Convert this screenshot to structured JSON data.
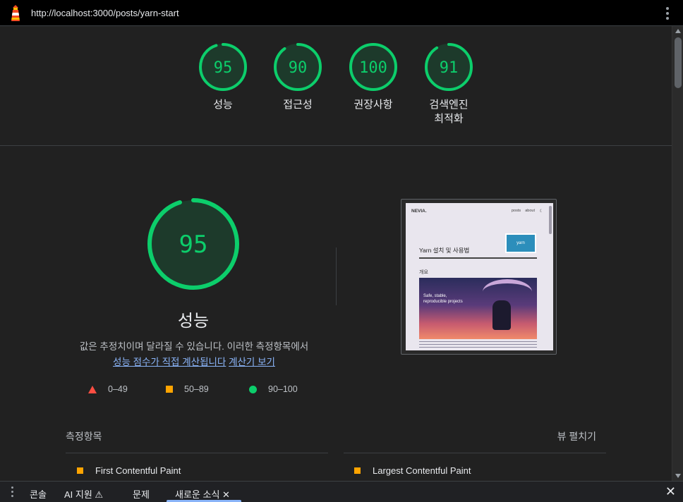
{
  "browser": {
    "url": "http://localhost:3000/posts/yarn-start"
  },
  "gauges": [
    {
      "score": 95,
      "label": "성능"
    },
    {
      "score": 90,
      "label": "접근성"
    },
    {
      "score": 100,
      "label": "권장사항"
    },
    {
      "score": 91,
      "label": "검색엔진\n최적화"
    }
  ],
  "performance": {
    "score": 95,
    "title": "성능",
    "desc_text": "값은 추정치이며 달라질 수 있습니다. 이러한 측정항목에서",
    "desc_link1": "성능 점수가 직접 계산됩니다",
    "desc_link2": "계산기 보기"
  },
  "legend": [
    {
      "range": "0–49",
      "color": "#ff4e42"
    },
    {
      "range": "50–89",
      "color": "#ffa400"
    },
    {
      "range": "90–100",
      "color": "#0cce6b"
    }
  ],
  "screenshot": {
    "brand": "NEVIA.",
    "nav": "posts    about",
    "post_title": "Yarn 설치 및 사용법",
    "section": "개요",
    "hero_text": "Safe, stable,\nreproducible projects",
    "logo_text": "yarn"
  },
  "metrics": {
    "heading": "측정항목",
    "expand_label": "뷰 펼치기",
    "items": [
      {
        "name": "First Contentful Paint",
        "color": "#ffa400"
      },
      {
        "name": "Largest Contentful Paint",
        "color": "#ffa400"
      }
    ]
  },
  "devtools_tabs": {
    "console": "콘솔",
    "ai": "AI 지원 ⚠",
    "issues": "문제",
    "whats_new": "새로운 소식 ✕",
    "close": "✕"
  },
  "colors": {
    "pass": "#0cce6b",
    "average": "#ffa400",
    "fail": "#ff4e42",
    "link": "#8ab4f8"
  }
}
